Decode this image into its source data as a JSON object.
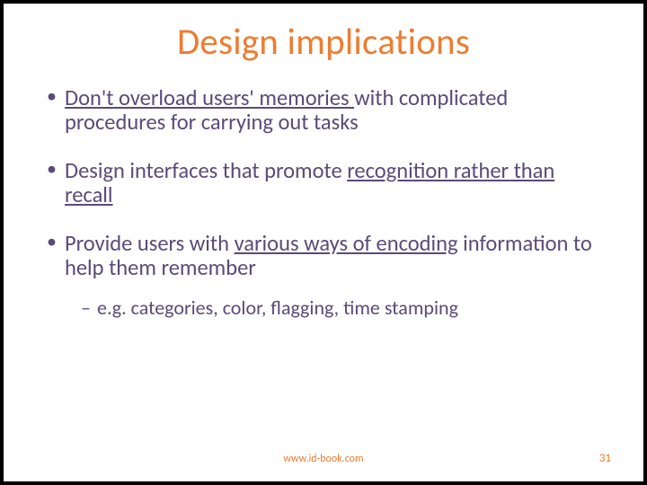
{
  "title": "Design implications",
  "bullets": [
    {
      "pre": "",
      "u": "Don't overload users' memories ",
      "post": "with complicated procedures for carrying out tasks"
    },
    {
      "pre": "Design interfaces that promote ",
      "u": "recognition rather than recall",
      "post": ""
    },
    {
      "pre": "Provide users with ",
      "u": "various ways of encoding",
      "post": " information to help them remember",
      "sub": "e.g. categories, color, flagging, time stamping"
    }
  ],
  "footer": {
    "center": "www.id-book.com",
    "page": "31"
  }
}
